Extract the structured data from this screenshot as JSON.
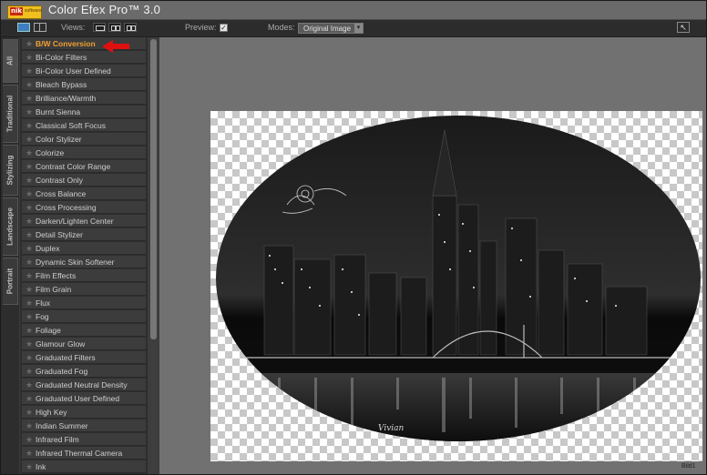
{
  "app": {
    "title": "Color Efex Pro™ 3.0",
    "logo_text": "nik",
    "logo_sub": "software"
  },
  "toolbar": {
    "views_label": "Views:",
    "preview_label": "Preview:",
    "preview_checked": "✓",
    "modes_label": "Modes:",
    "modes_value": "Original Image"
  },
  "tabs": [
    {
      "label": "All"
    },
    {
      "label": "Traditional"
    },
    {
      "label": "Stylizing"
    },
    {
      "label": "Landscape"
    },
    {
      "label": "Portrait"
    }
  ],
  "filters": [
    {
      "label": "B/W Conversion"
    },
    {
      "label": "Bi-Color Filters"
    },
    {
      "label": "Bi-Color User Defined"
    },
    {
      "label": "Bleach Bypass"
    },
    {
      "label": "Brilliance/Warmth"
    },
    {
      "label": "Burnt Sienna"
    },
    {
      "label": "Classical Soft Focus"
    },
    {
      "label": "Color Stylizer"
    },
    {
      "label": "Colorize"
    },
    {
      "label": "Contrast Color Range"
    },
    {
      "label": "Contrast Only"
    },
    {
      "label": "Cross Balance"
    },
    {
      "label": "Cross Processing"
    },
    {
      "label": "Darken/Lighten Center"
    },
    {
      "label": "Detail Stylizer"
    },
    {
      "label": "Duplex"
    },
    {
      "label": "Dynamic Skin Softener"
    },
    {
      "label": "Film Effects"
    },
    {
      "label": "Film Grain"
    },
    {
      "label": "Flux"
    },
    {
      "label": "Fog"
    },
    {
      "label": "Foliage"
    },
    {
      "label": "Glamour Glow"
    },
    {
      "label": "Graduated Filters"
    },
    {
      "label": "Graduated Fog"
    },
    {
      "label": "Graduated Neutral Density"
    },
    {
      "label": "Graduated User Defined"
    },
    {
      "label": "High Key"
    },
    {
      "label": "Indian Summer"
    },
    {
      "label": "Infrared Film"
    },
    {
      "label": "Infrared Thermal Camera"
    },
    {
      "label": "Ink"
    }
  ],
  "selected_filter_color": "#f0a030",
  "canvas": {
    "signature": "Vivian",
    "corner_label": "Bild1"
  }
}
